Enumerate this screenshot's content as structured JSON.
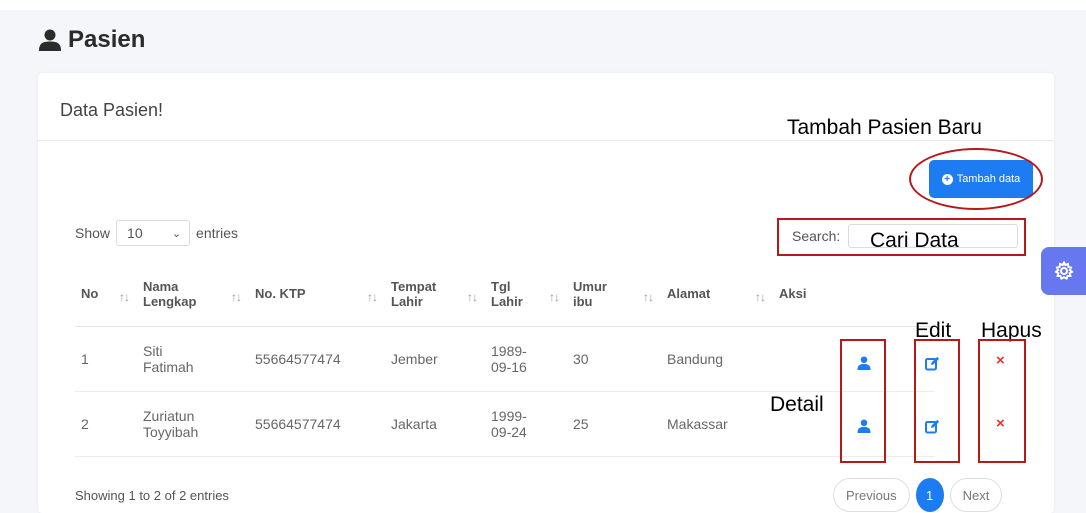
{
  "page": {
    "title": "Pasien",
    "icon": "user-icon"
  },
  "card": {
    "title": "Data Pasien!"
  },
  "toolbar": {
    "add_label": "Tambah data",
    "add_icon": "plus-circle-icon"
  },
  "length_menu": {
    "show": "Show",
    "value": "10",
    "entries": "entries"
  },
  "search": {
    "label": "Search:",
    "value": ""
  },
  "table": {
    "headers": [
      "No",
      "Nama Lengkap",
      "No. KTP",
      "Tempat Lahir",
      "Tgl Lahir",
      "Umur ibu",
      "Alamat",
      "Aksi"
    ],
    "rows": [
      {
        "no": "1",
        "nama": "Siti Fatimah",
        "ktp": "55664577474",
        "tempat": "Jember",
        "tgl": "1989-09-16",
        "umur": "30",
        "alamat": "Bandung"
      },
      {
        "no": "2",
        "nama": "Zuriatun Toyyibah",
        "ktp": "55664577474",
        "tempat": "Jakarta",
        "tgl": "1999-09-24",
        "umur": "25",
        "alamat": "Makassar"
      }
    ]
  },
  "footer": {
    "info": "Showing 1 to 2 of 2 entries",
    "prev": "Previous",
    "current": "1",
    "next": "Next"
  },
  "annotations": {
    "add": "Tambah Pasien Baru",
    "search": "Cari Data",
    "edit": "Edit",
    "delete": "Hapus",
    "detail": "Detail"
  },
  "colors": {
    "primary": "#1e7cf2",
    "annotation": "#b7191b",
    "settings": "#6777ef",
    "delete": "#e3342f"
  }
}
